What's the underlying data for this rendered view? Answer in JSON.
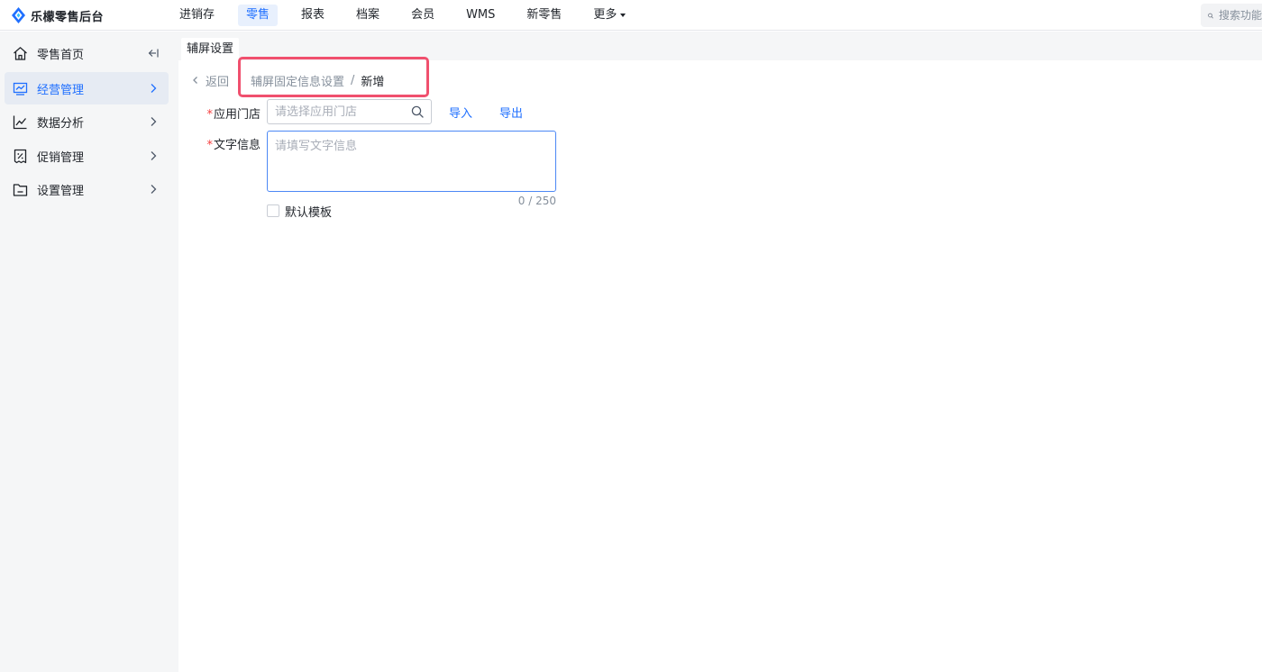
{
  "brand": {
    "name": "乐檬零售后台",
    "color": "#1f6fff"
  },
  "nav": {
    "items": [
      {
        "label": "进销存",
        "active": false
      },
      {
        "label": "零售",
        "active": true
      },
      {
        "label": "报表",
        "active": false
      },
      {
        "label": "档案",
        "active": false
      },
      {
        "label": "会员",
        "active": false
      },
      {
        "label": "WMS",
        "active": false
      },
      {
        "label": "新零售",
        "active": false
      },
      {
        "label": "更多",
        "active": false,
        "dropdown": true
      }
    ]
  },
  "search": {
    "placeholder": "搜索功能"
  },
  "sidebar": {
    "items": [
      {
        "label": "零售首页",
        "icon": "home-icon",
        "trailing": "collapse-icon",
        "active": false
      },
      {
        "label": "经营管理",
        "icon": "monitor-chart-icon",
        "trailing": "chevron-right-icon",
        "active": true
      },
      {
        "label": "数据分析",
        "icon": "line-chart-icon",
        "trailing": "chevron-right-icon",
        "active": false
      },
      {
        "label": "促销管理",
        "icon": "promo-tag-icon",
        "trailing": "chevron-right-icon",
        "active": false
      },
      {
        "label": "设置管理",
        "icon": "folder-icon",
        "trailing": "chevron-right-icon",
        "active": false
      }
    ]
  },
  "tabs": {
    "active_label": "辅屏设置"
  },
  "page": {
    "back_label": "返回",
    "breadcrumb": {
      "parent": "辅屏固定信息设置",
      "separator": "/",
      "current": "新增"
    },
    "highlight_color": "#f0506e"
  },
  "form": {
    "required_mark": "*",
    "store": {
      "label": "应用门店",
      "placeholder": "请选择应用门店",
      "value": ""
    },
    "import_label": "导入",
    "export_label": "导出",
    "text_info": {
      "label": "文字信息",
      "placeholder": "请填写文字信息",
      "value": "",
      "counter": "0 / 250"
    },
    "default_template": {
      "label": "默认模板",
      "checked": false
    }
  }
}
